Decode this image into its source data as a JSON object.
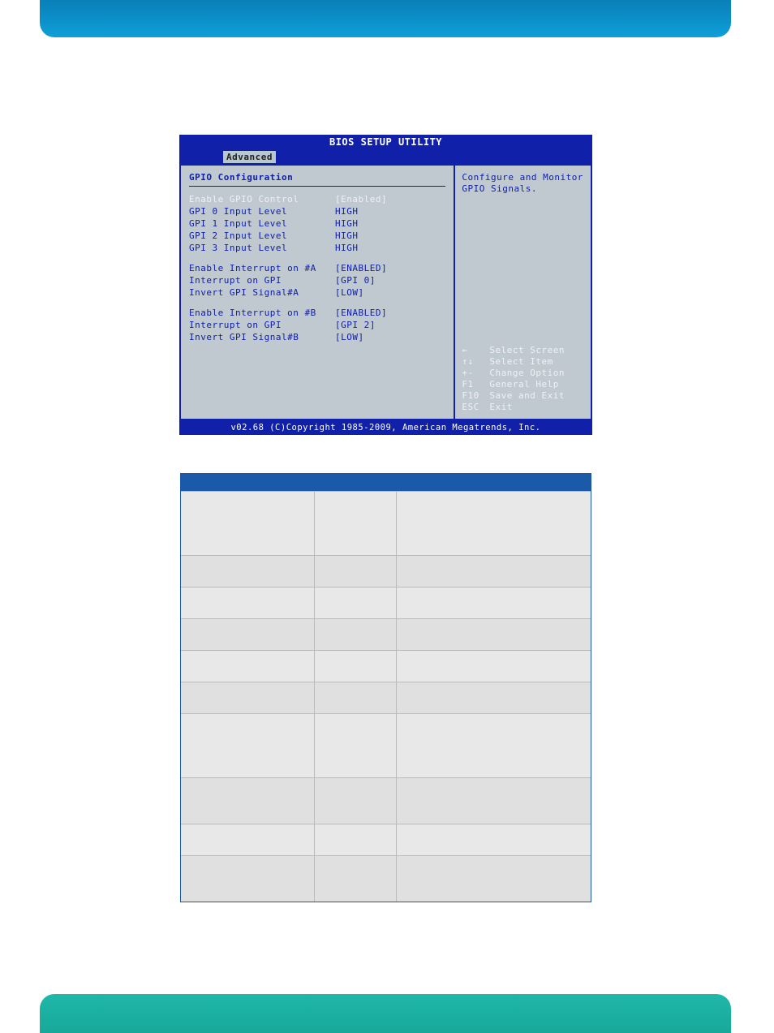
{
  "bios": {
    "title": "BIOS SETUP UTILITY",
    "tab": "Advanced",
    "section_title": "GPIO Configuration",
    "rows_a": [
      {
        "label": "Enable GPIO Control",
        "value": "[Enabled]",
        "selected": true
      },
      {
        "label": "GPI 0 Input Level",
        "value": "HIGH"
      },
      {
        "label": "GPI 1 Input Level",
        "value": "HIGH"
      },
      {
        "label": "GPI 2 Input Level",
        "value": "HIGH"
      },
      {
        "label": "GPI 3 Input Level",
        "value": "HIGH"
      }
    ],
    "rows_b": [
      {
        "label": "Enable Interrupt on #A",
        "value": "[ENABLED]"
      },
      {
        "label": "Interrupt on GPI",
        "value": "[GPI 0]"
      },
      {
        "label": "Invert GPI Signal#A",
        "value": "[LOW]"
      }
    ],
    "rows_c": [
      {
        "label": "Enable Interrupt on #B",
        "value": "[ENABLED]"
      },
      {
        "label": "Interrupt on GPI",
        "value": "[GPI 2]"
      },
      {
        "label": "Invert GPI Signal#B",
        "value": "[LOW]"
      }
    ],
    "help_text": "Configure and Monitor GPIO Signals.",
    "help_keys": [
      {
        "key": "←",
        "desc": "Select Screen"
      },
      {
        "key": "↑↓",
        "desc": "Select Item"
      },
      {
        "key": "+-",
        "desc": "Change Option"
      },
      {
        "key": "F1",
        "desc": "General Help"
      },
      {
        "key": "F10",
        "desc": "Save and Exit"
      },
      {
        "key": "ESC",
        "desc": "Exit"
      }
    ],
    "footer": "v02.68 (C)Copyright 1985-2009, American Megatrends, Inc."
  },
  "table": {
    "rows": [
      {
        "c1": "",
        "c2": "",
        "c3": "",
        "h": "h60"
      },
      {
        "c1": "",
        "c2": "",
        "c3": "",
        "h": "h30"
      },
      {
        "c1": "",
        "c2": "",
        "c3": "",
        "h": "h30"
      },
      {
        "c1": "",
        "c2": "",
        "c3": "",
        "h": "h30"
      },
      {
        "c1": "",
        "c2": "",
        "c3": "",
        "h": "h30"
      },
      {
        "c1": "",
        "c2": "",
        "c3": "",
        "h": "h30"
      },
      {
        "c1": "",
        "c2": "",
        "c3": "",
        "h": "h60"
      },
      {
        "c1": "",
        "c2": "",
        "c3": "",
        "h": "h40"
      },
      {
        "c1": "",
        "c2": "",
        "c3": "",
        "h": "h30"
      },
      {
        "c1": "",
        "c2": "",
        "c3": "",
        "h": "h40"
      }
    ]
  }
}
